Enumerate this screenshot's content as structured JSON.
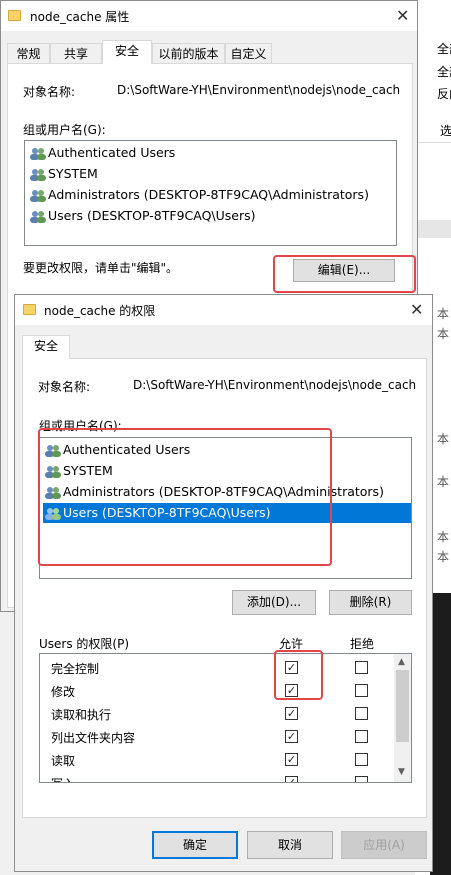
{
  "background_window": {
    "right_items": [
      "全部",
      "全部",
      "反向",
      "选",
      "本",
      "本",
      "本",
      "本",
      "本",
      "本"
    ]
  },
  "props": {
    "title": "node_cache 属性",
    "close": "✕",
    "tabs": [
      "常规",
      "共享",
      "安全",
      "以前的版本",
      "自定义"
    ],
    "object_label": "对象名称:",
    "object_value": "D:\\SoftWare-YH\\Environment\\nodejs\\node_cach",
    "group_label": "组或用户名(G):",
    "users": [
      "Authenticated Users",
      "SYSTEM",
      "Administrators (DESKTOP-8TF9CAQ\\Administrators)",
      "Users (DESKTOP-8TF9CAQ\\Users)"
    ],
    "change_hint": "要更改权限，请单击\"编辑\"。",
    "edit_button": "编辑(E)..."
  },
  "perm": {
    "title": "node_cache 的权限",
    "close": "✕",
    "tab": "安全",
    "object_label": "对象名称:",
    "object_value": "D:\\SoftWare-YH\\Environment\\nodejs\\node_cach",
    "group_label": "组或用户名(G):",
    "users": [
      "Authenticated Users",
      "SYSTEM",
      "Administrators (DESKTOP-8TF9CAQ\\Administrators)",
      "Users (DESKTOP-8TF9CAQ\\Users)"
    ],
    "selected_user": "Users (DESKTOP-8TF9CAQ\\Users)",
    "add_button": "添加(D)...",
    "remove_button": "删除(R)",
    "perm_header": "Users 的权限(P)",
    "allow_header": "允许",
    "deny_header": "拒绝",
    "permissions": [
      {
        "name": "完全控制",
        "allow": true,
        "deny": false
      },
      {
        "name": "修改",
        "allow": true,
        "deny": false
      },
      {
        "name": "读取和执行",
        "allow": true,
        "deny": false
      },
      {
        "name": "列出文件夹内容",
        "allow": true,
        "deny": false
      },
      {
        "name": "读取",
        "allow": true,
        "deny": false
      },
      {
        "name": "写入",
        "allow": true,
        "deny": false
      }
    ],
    "ok_button": "确定",
    "cancel_button": "取消",
    "apply_button": "应用(A)"
  },
  "colors": {
    "highlight": "#0078d7",
    "annotation": "#e0474c"
  }
}
